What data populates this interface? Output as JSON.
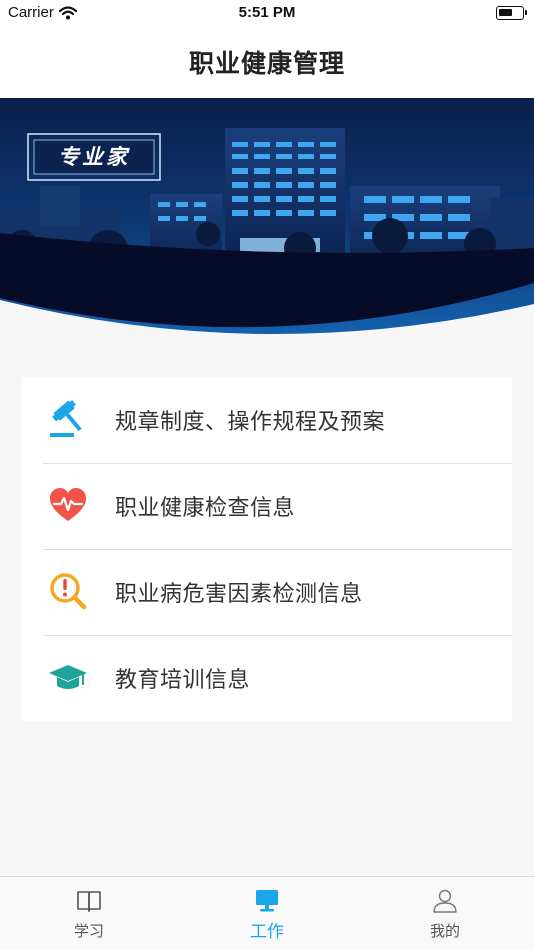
{
  "status_bar": {
    "carrier": "Carrier",
    "time": "5:51 PM"
  },
  "nav": {
    "title": "职业健康管理"
  },
  "banner": {
    "logo_text": "专业家"
  },
  "menu": {
    "items": [
      {
        "label": "规章制度、操作规程及预案",
        "icon": "gavel-icon",
        "color": "#1aa6e8"
      },
      {
        "label": "职业健康检查信息",
        "icon": "heart-pulse-icon",
        "color": "#f0534a"
      },
      {
        "label": "职业病危害因素检测信息",
        "icon": "alert-search-icon",
        "color": "#f5a623"
      },
      {
        "label": "教育培训信息",
        "icon": "graduation-cap-icon",
        "color": "#1fa39a"
      }
    ]
  },
  "tab_bar": {
    "tabs": [
      {
        "label": "学习",
        "icon": "book-icon",
        "active": false
      },
      {
        "label": "工作",
        "icon": "monitor-icon",
        "active": true
      },
      {
        "label": "我的",
        "icon": "user-icon",
        "active": false
      }
    ],
    "active_color": "#1aa6e8"
  }
}
